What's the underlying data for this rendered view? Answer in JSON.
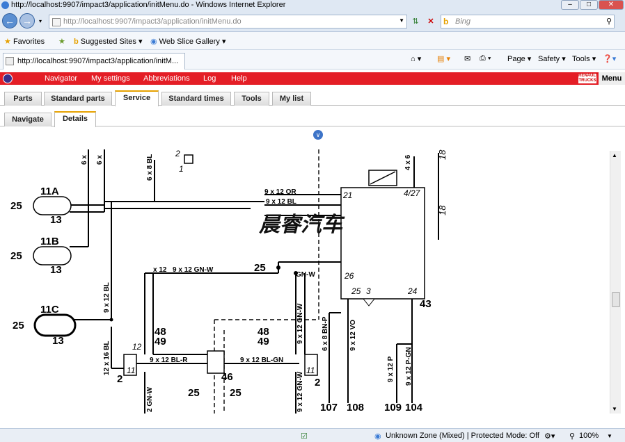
{
  "window": {
    "title": "http://localhost:9907/impact3/application/initMenu.do - Windows Internet Explorer",
    "address": "http://localhost:9907/impact3/application/initMenu.do",
    "search_placeholder": "Bing"
  },
  "favorites_bar": {
    "favorites": "Favorites",
    "suggested_sites": "Suggested Sites ▾",
    "web_slice_gallery": "Web Slice Gallery ▾"
  },
  "tab": {
    "title": "http://localhost:9907/impact3/application/initM..."
  },
  "command_bar": {
    "page": "Page ▾",
    "safety": "Safety ▾",
    "tools": "Tools ▾"
  },
  "app_nav": {
    "items": [
      "Navigator",
      "My settings",
      "Abbreviations",
      "Log",
      "Help"
    ],
    "menu": "Menu",
    "brand": "RENAULT TRUCKS"
  },
  "main_tabs": [
    "Parts",
    "Standard parts",
    "Service",
    "Standard times",
    "Tools",
    "My list"
  ],
  "main_tab_active": "Service",
  "sub_tabs": [
    "Navigate",
    "Details"
  ],
  "sub_tab_active": "Details",
  "diagram": {
    "watermark": "晨睿汽车",
    "components": {
      "c11A": "11A",
      "c11B": "11B",
      "c11C": "11C",
      "c25": "25",
      "c13": "13",
      "c12": "12",
      "c2": "2",
      "c11": "11",
      "c46": "46",
      "c48": "48",
      "c49": "49",
      "c43": "43",
      "c107": "107",
      "c108": "108",
      "c109": "109",
      "c104": "104",
      "c21": "21",
      "c427": "4/27",
      "c26": "26",
      "c3": "3",
      "c24": "24",
      "c18": "18",
      "c1": "1",
      "c2b": "2"
    },
    "wires": {
      "w6x": "6 x",
      "w6x8bl": "6 x 8 BL",
      "w9x12bl": "9 x 12 BL",
      "w12x16bl": "12 x 16 BL",
      "w2gnw": "2 GN-W",
      "w9x12gnw": "9 x 12 GN-W",
      "wx12": "x 12",
      "w9x12blr": "9 x 12 BL-R",
      "w9x12blgn": "9 x 12 BL-GN",
      "w9x12or": "9 x 12 OR",
      "w9x12bl_b": "9 x 12 BL",
      "wgnw": "GN-W",
      "w9x12vo": "9 x 12 VO",
      "w6x8bnp": "6 x 8 BN-P",
      "w9x12p": "9 x 12 P",
      "w9x12pgn": "9 x 12 P-GN",
      "w4x6": "4 x 6"
    }
  },
  "status_bar": {
    "zone": "Unknown Zone (Mixed) | Protected Mode: Off",
    "zoom": "100%"
  }
}
